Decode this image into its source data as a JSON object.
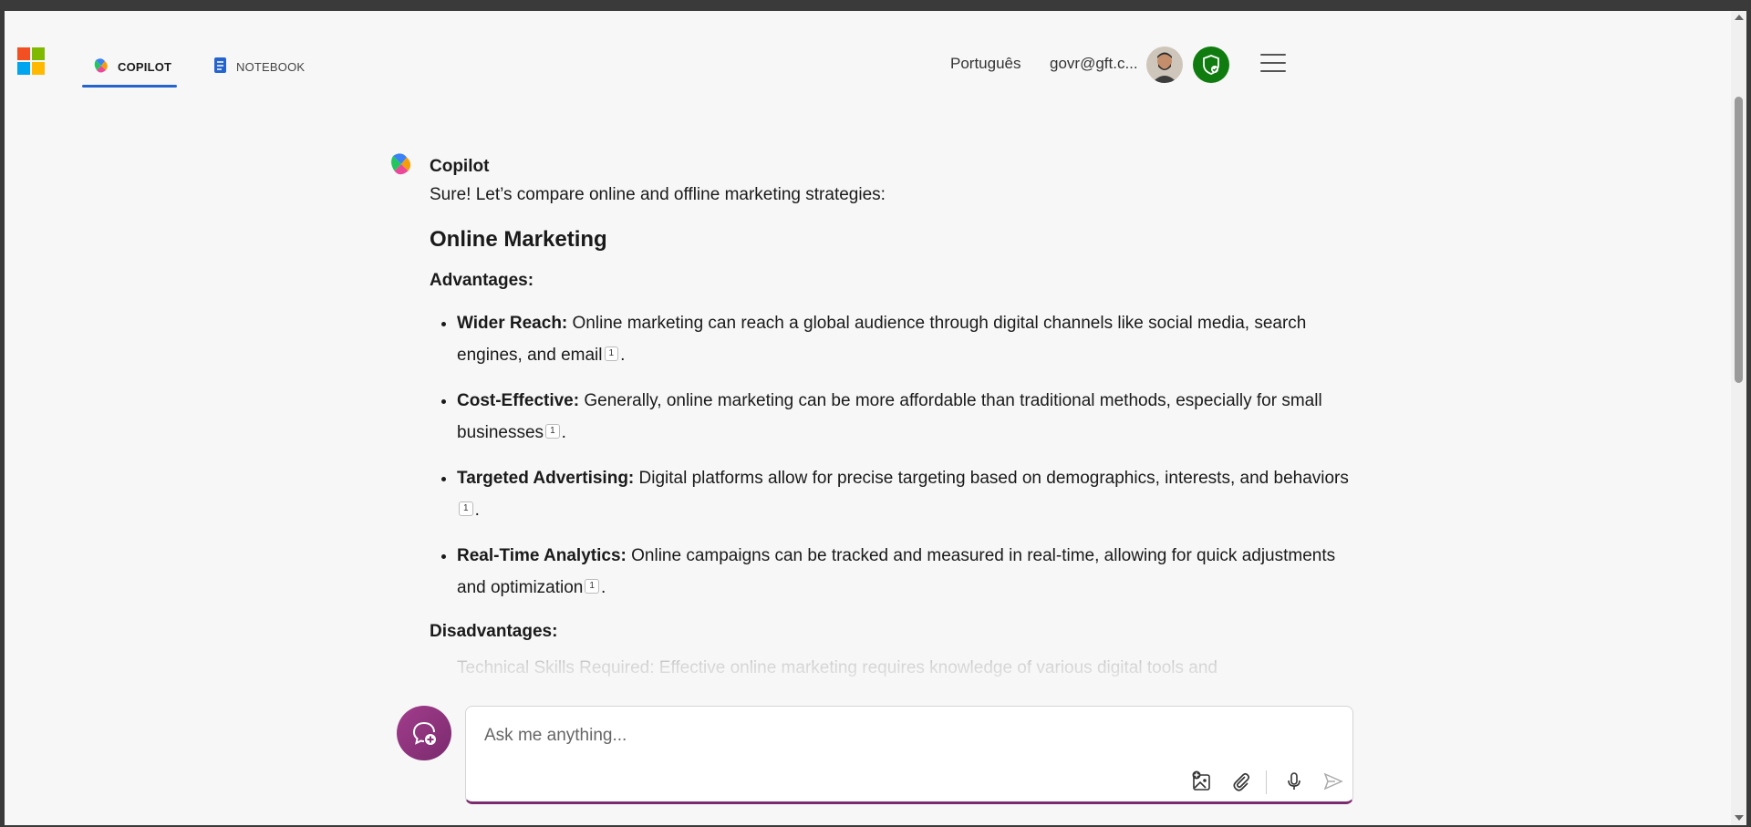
{
  "header": {
    "tabs": [
      {
        "label": "COPILOT",
        "active": true
      },
      {
        "label": "NOTEBOOK",
        "active": false
      }
    ],
    "language": "Português",
    "account": "govr@gft.c..."
  },
  "colors": {
    "accent": "#2564cf",
    "brand_purple": "#7b2c6f",
    "shield_green": "#107c10"
  },
  "message": {
    "author": "Copilot",
    "intro": "Sure! Let’s compare online and offline marketing strategies:",
    "heading": "Online Marketing",
    "advantages_label": "Advantages:",
    "advantages": [
      {
        "title": "Wider Reach:",
        "text": "Online marketing can reach a global audience through digital channels like social media, search engines, and email",
        "cite": "1"
      },
      {
        "title": "Cost-Effective:",
        "text": "Generally, online marketing can be more affordable than traditional methods, especially for small businesses",
        "cite": "1"
      },
      {
        "title": "Targeted Advertising:",
        "text": "Digital platforms allow for precise targeting based on demographics, interests, and behaviors",
        "cite": "1"
      },
      {
        "title": "Real-Time Analytics:",
        "text": "Online campaigns can be tracked and measured in real-time, allowing for quick adjustments and optimization",
        "cite": "1"
      }
    ],
    "disadvantages_label": "Disadvantages:",
    "faded_item": "Technical Skills Required: Effective online marketing requires knowledge of various digital tools and"
  },
  "composer": {
    "placeholder": "Ask me anything..."
  }
}
